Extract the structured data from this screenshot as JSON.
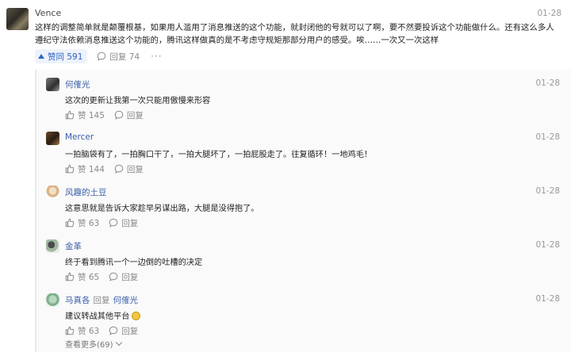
{
  "top_comment": {
    "author": "Vence",
    "date": "01-28",
    "text": "这样的调整简单就是颠覆根基，如果用人滥用了消息推送的这个功能，就封闭他的号就可以了啊，要不然要投诉这个功能做什么。还有这么多人遵纪守法依赖消息推送这个功能的，腾讯这样做真的是不考虑守规矩那部分用户的感受。唉……一次又一次这样",
    "vote_label": "赞同 591",
    "comment_label": "回复 74",
    "more": "···"
  },
  "replies": [
    {
      "author": "何傕光",
      "date": "01-28",
      "text": "这次的更新让我第一次只能用傲慢来形容",
      "likes": "赞 145",
      "reply_label": "回复"
    },
    {
      "author": "Mercer",
      "date": "01-28",
      "text": "一拍脑袋有了，一拍胸口干了，一拍大腿坏了，一拍屁股走了。往复循环！一地鸡毛！",
      "likes": "赞 144",
      "reply_label": "回复"
    },
    {
      "author": "风趣的土豆",
      "date": "01-28",
      "text": "这意思就是告诉大家趁早另谋出路，大腿是没得抱了。",
      "likes": "赞 63",
      "reply_label": "回复"
    },
    {
      "author": "金革",
      "date": "01-28",
      "text": "终于看到腾讯一个一边倒的吐槽的决定",
      "likes": "赞 65",
      "reply_label": "回复"
    },
    {
      "author": "马真各",
      "reply_word": "回复",
      "reply_to": "何傕光",
      "date": "01-28",
      "text": "建议转战其他平台",
      "likes": "赞 63",
      "reply_label": "回复"
    }
  ],
  "view_more": "查看更多(69)"
}
